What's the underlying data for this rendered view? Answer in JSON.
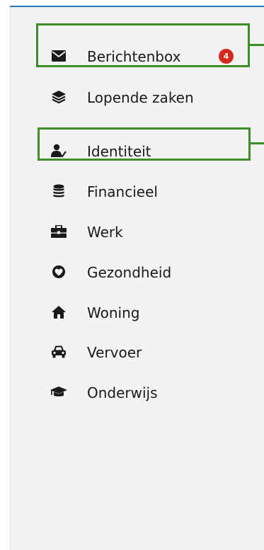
{
  "nav": {
    "items": [
      {
        "id": "berichtenbox",
        "label": "Berichtenbox",
        "icon": "envelope-icon",
        "badge": "4"
      },
      {
        "id": "lopende-zaken",
        "label": "Lopende zaken",
        "icon": "layers-icon"
      },
      {
        "id": "identiteit",
        "label": "Identiteit",
        "icon": "user-check-icon"
      },
      {
        "id": "financieel",
        "label": "Financieel",
        "icon": "coins-icon"
      },
      {
        "id": "werk",
        "label": "Werk",
        "icon": "briefcase-icon"
      },
      {
        "id": "gezondheid",
        "label": "Gezondheid",
        "icon": "heart-icon"
      },
      {
        "id": "woning",
        "label": "Woning",
        "icon": "house-icon"
      },
      {
        "id": "vervoer",
        "label": "Vervoer",
        "icon": "car-icon"
      },
      {
        "id": "onderwijs",
        "label": "Onderwijs",
        "icon": "graduation-cap-icon"
      }
    ]
  },
  "colors": {
    "accent_line": "#1f77b7",
    "badge": "#d7261e",
    "highlight": "#3e8c25",
    "sidebar_bg": "#f3f3f3"
  }
}
